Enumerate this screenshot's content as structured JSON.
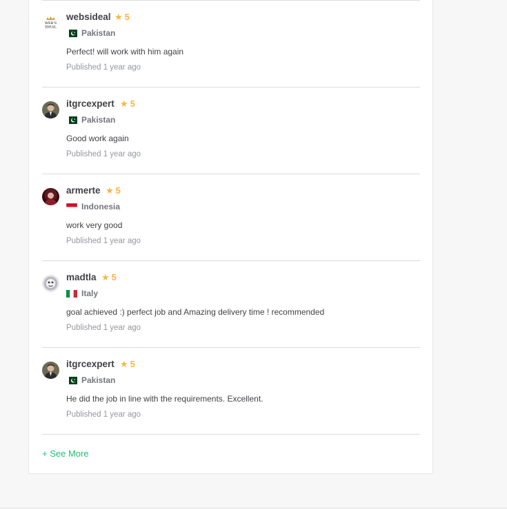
{
  "reviews": [
    {
      "username": "websideal",
      "rating": "5",
      "country": "Pakistan",
      "flag": "pk",
      "avatar_icon": "websideal-logo-icon",
      "comment": "Perfect! will work with him again",
      "published_label": "Published",
      "published_time": "1 year ago"
    },
    {
      "username": "itgrcexpert",
      "rating": "5",
      "country": "Pakistan",
      "flag": "pk",
      "avatar_icon": "user-photo-icon",
      "comment": "Good work again",
      "published_label": "Published",
      "published_time": "1 year ago"
    },
    {
      "username": "armerte",
      "rating": "5",
      "country": "Indonesia",
      "flag": "id",
      "avatar_icon": "user-photo-icon",
      "comment": "work very good",
      "published_label": "Published",
      "published_time": "1 year ago"
    },
    {
      "username": "madtla",
      "rating": "5",
      "country": "Italy",
      "flag": "it",
      "avatar_icon": "user-photo-icon",
      "comment": "goal achieved :) perfect job and Amazing delivery time ! recommended",
      "published_label": "Published",
      "published_time": "1 year ago"
    },
    {
      "username": "itgrcexpert",
      "rating": "5",
      "country": "Pakistan",
      "flag": "pk",
      "avatar_icon": "user-photo-icon",
      "comment": "He did the job in line with the requirements. Excellent.",
      "published_label": "Published",
      "published_time": "1 year ago"
    }
  ],
  "see_more": "+ See More",
  "colors": {
    "star": "#ffb33e",
    "link": "#1dbf73",
    "text": "#404145",
    "muted": "#95979d"
  }
}
